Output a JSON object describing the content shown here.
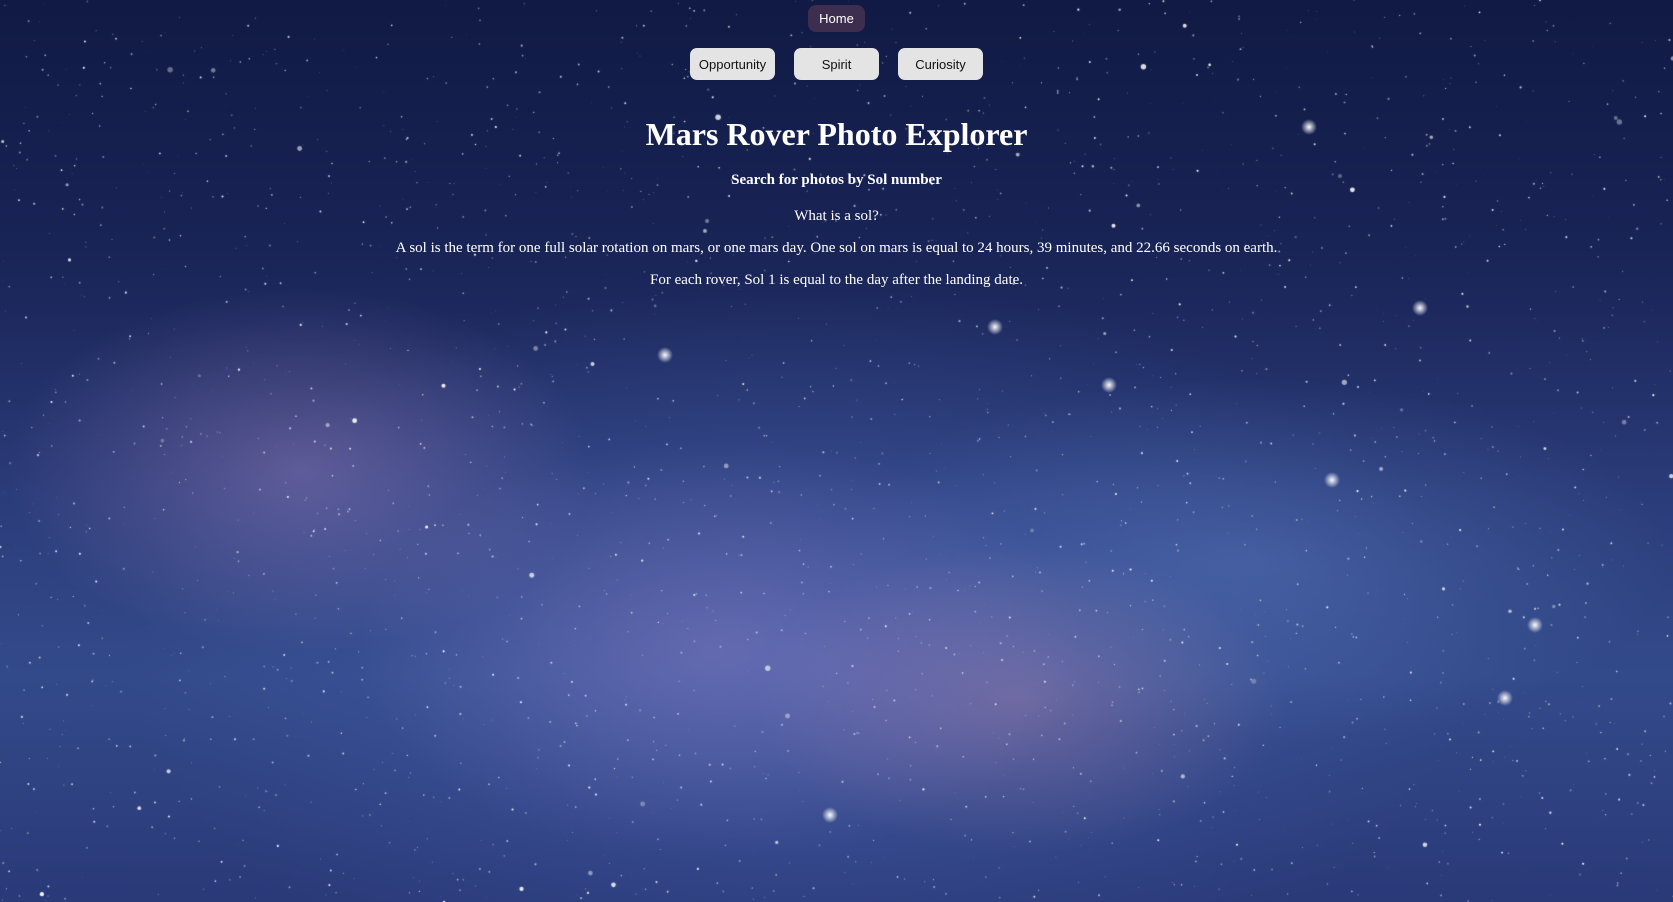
{
  "nav": {
    "home_label": "Home",
    "rovers": [
      "Opportunity",
      "Spirit",
      "Curiosity"
    ]
  },
  "main": {
    "title": "Mars Rover Photo Explorer",
    "subtitle": "Search for photos by Sol number",
    "question": "What is a sol?",
    "definition": "A sol is the term for one full solar rotation on mars, or one mars day. One sol on mars is equal to 24 hours, 39 minutes, and 22.66 seconds on earth.",
    "note": "For each rover, Sol 1 is equal to the day after the landing date."
  },
  "colors": {
    "home_bg": "#3d2d4f",
    "button_bg": "#e4e4e4",
    "sky_dark": "#101a44",
    "sky_light": "#334a8a"
  }
}
